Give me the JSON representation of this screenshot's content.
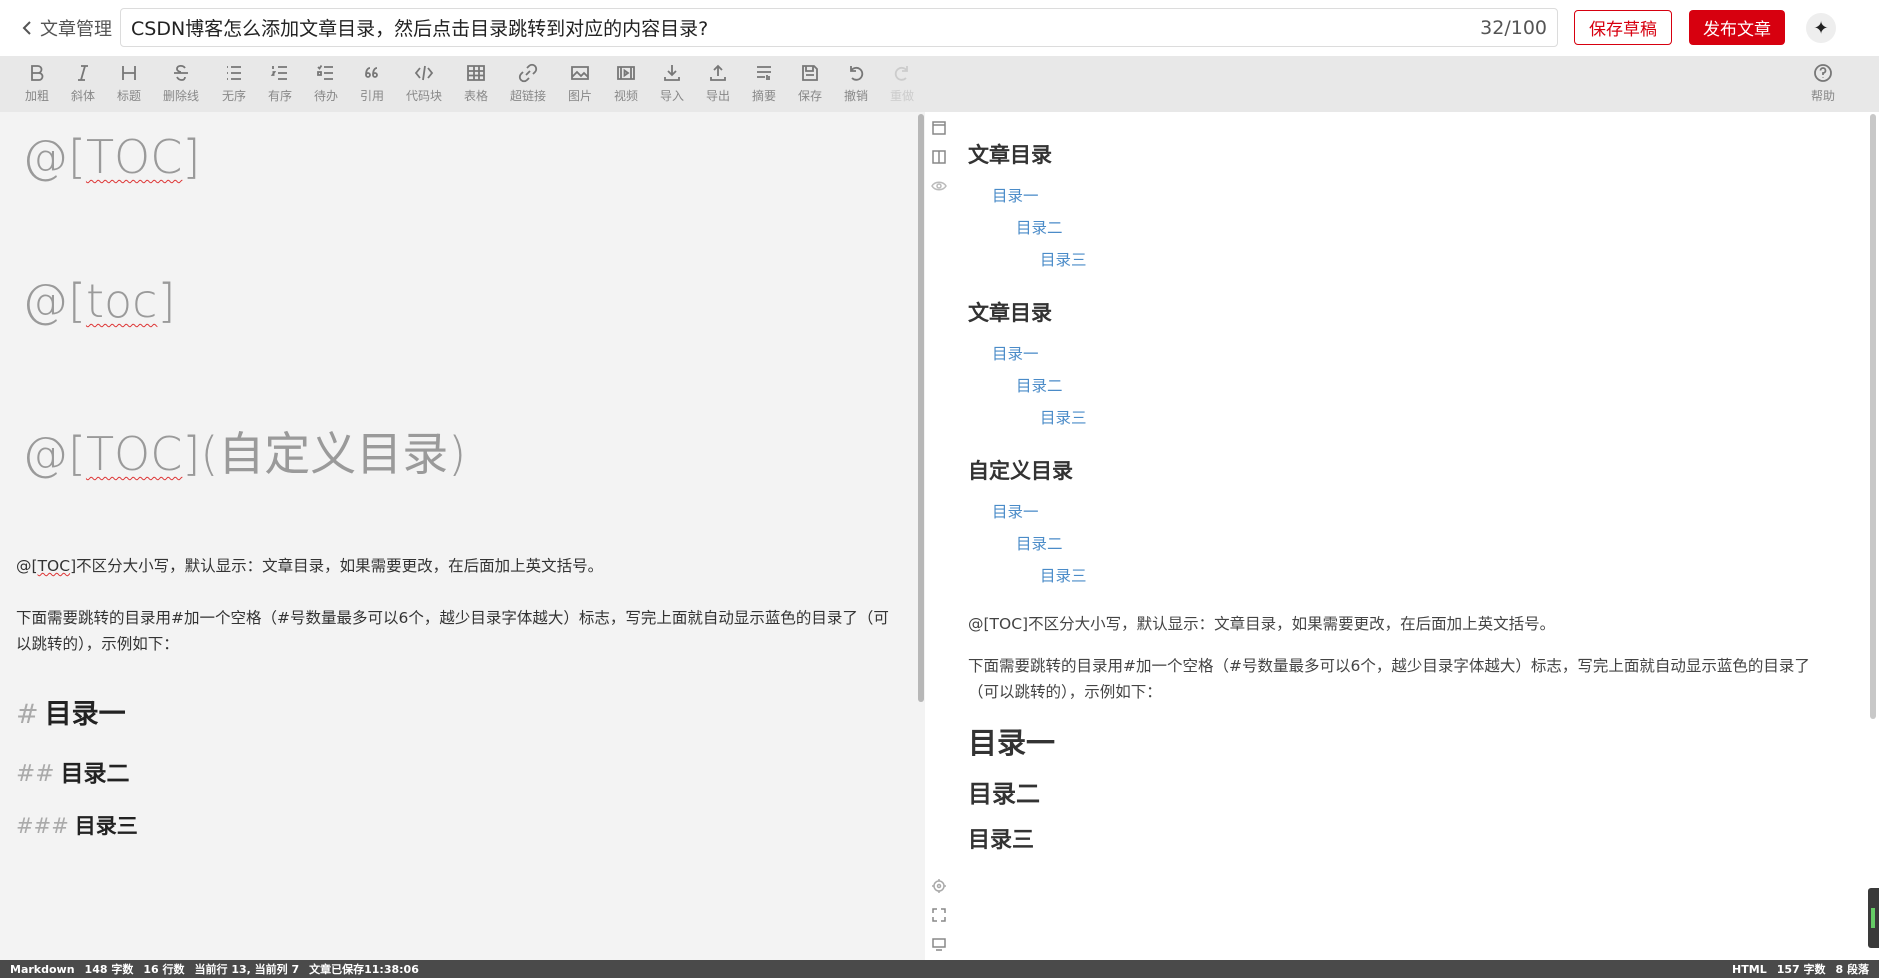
{
  "header": {
    "back_label": "文章管理",
    "title_value": "CSDN博客怎么添加文章目录，然后点击目录跳转到对应的内容目录?",
    "title_count": "32/100",
    "save_draft_label": "保存草稿",
    "publish_label": "发布文章",
    "avatar_glyph": "✦"
  },
  "toolbar": {
    "items": [
      {
        "label": "加粗",
        "icon": "bold-icon"
      },
      {
        "label": "斜体",
        "icon": "italic-icon"
      },
      {
        "label": "标题",
        "icon": "heading-icon"
      },
      {
        "label": "删除线",
        "icon": "strikethrough-icon"
      },
      {
        "label": "无序",
        "icon": "unordered-list-icon"
      },
      {
        "label": "有序",
        "icon": "ordered-list-icon"
      },
      {
        "label": "待办",
        "icon": "todo-list-icon"
      },
      {
        "label": "引用",
        "icon": "quote-icon"
      },
      {
        "label": "代码块",
        "icon": "code-block-icon"
      },
      {
        "label": "表格",
        "icon": "table-icon"
      },
      {
        "label": "超链接",
        "icon": "link-icon"
      },
      {
        "label": "图片",
        "icon": "image-icon"
      },
      {
        "label": "视频",
        "icon": "video-icon"
      },
      {
        "label": "导入",
        "icon": "import-icon"
      },
      {
        "label": "导出",
        "icon": "export-icon"
      },
      {
        "label": "摘要",
        "icon": "summary-icon"
      },
      {
        "label": "保存",
        "icon": "save-icon"
      },
      {
        "label": "撤销",
        "icon": "undo-icon"
      },
      {
        "label": "重做",
        "icon": "redo-icon"
      }
    ],
    "help_label": "帮助"
  },
  "editor": {
    "toc_line_1": {
      "prefix": "@[",
      "word": "TOC",
      "suffix": "]"
    },
    "toc_line_2": {
      "prefix": "@[",
      "word": "toc",
      "suffix": "]"
    },
    "toc_line_3": {
      "prefix": "@[",
      "word": "TOC",
      "suffix": "](自定义目录)"
    },
    "para_1": {
      "prefix": "@[",
      "word": "TOC",
      "rest": "]不区分大小写，默认显示：文章目录，如果需要更改，在后面加上英文括号。"
    },
    "para_2": "下面需要跳转的目录用#加一个空格（#号数量最多可以6个，越少目录字体越大）标志，写完上面就自动显示蓝色的目录了（可以跳转的），示例如下：",
    "h1": {
      "hash": "#",
      "text": "目录一"
    },
    "h2": {
      "hash": "##",
      "text": "目录二"
    },
    "h3": {
      "hash": "###",
      "text": "目录三"
    }
  },
  "preview": {
    "toc_blocks": [
      {
        "title": "文章目录",
        "links": [
          "目录一",
          "目录二",
          "目录三"
        ]
      },
      {
        "title": "文章目录",
        "links": [
          "目录一",
          "目录二",
          "目录三"
        ]
      },
      {
        "title": "自定义目录",
        "links": [
          "目录一",
          "目录二",
          "目录三"
        ]
      }
    ],
    "para_1": "@[TOC]不区分大小写，默认显示：文章目录，如果需要更改，在后面加上英文括号。",
    "para_2": "下面需要跳转的目录用#加一个空格（#号数量最多可以6个，越少目录字体越大）标志，写完上面就自动显示蓝色的目录了（可以跳转的），示例如下：",
    "h1": "目录一",
    "h2": "目录二",
    "h3": "目录三"
  },
  "statusbar": {
    "mode": "Markdown",
    "chars": "148 字数",
    "lines": "16 行数",
    "cursor": "当前行 13, 当前列 7",
    "saved": "文章已保存11:38:06",
    "right_mode": "HTML",
    "right_chars": "157 字数",
    "paragraphs": "8 段落"
  },
  "colors": {
    "brand_red": "#d7000f",
    "link_blue": "#4a8bc8",
    "editor_bg": "#f3f3f3",
    "toolbar_bg": "#e8e8e8",
    "status_bg": "#4a4a4a"
  }
}
